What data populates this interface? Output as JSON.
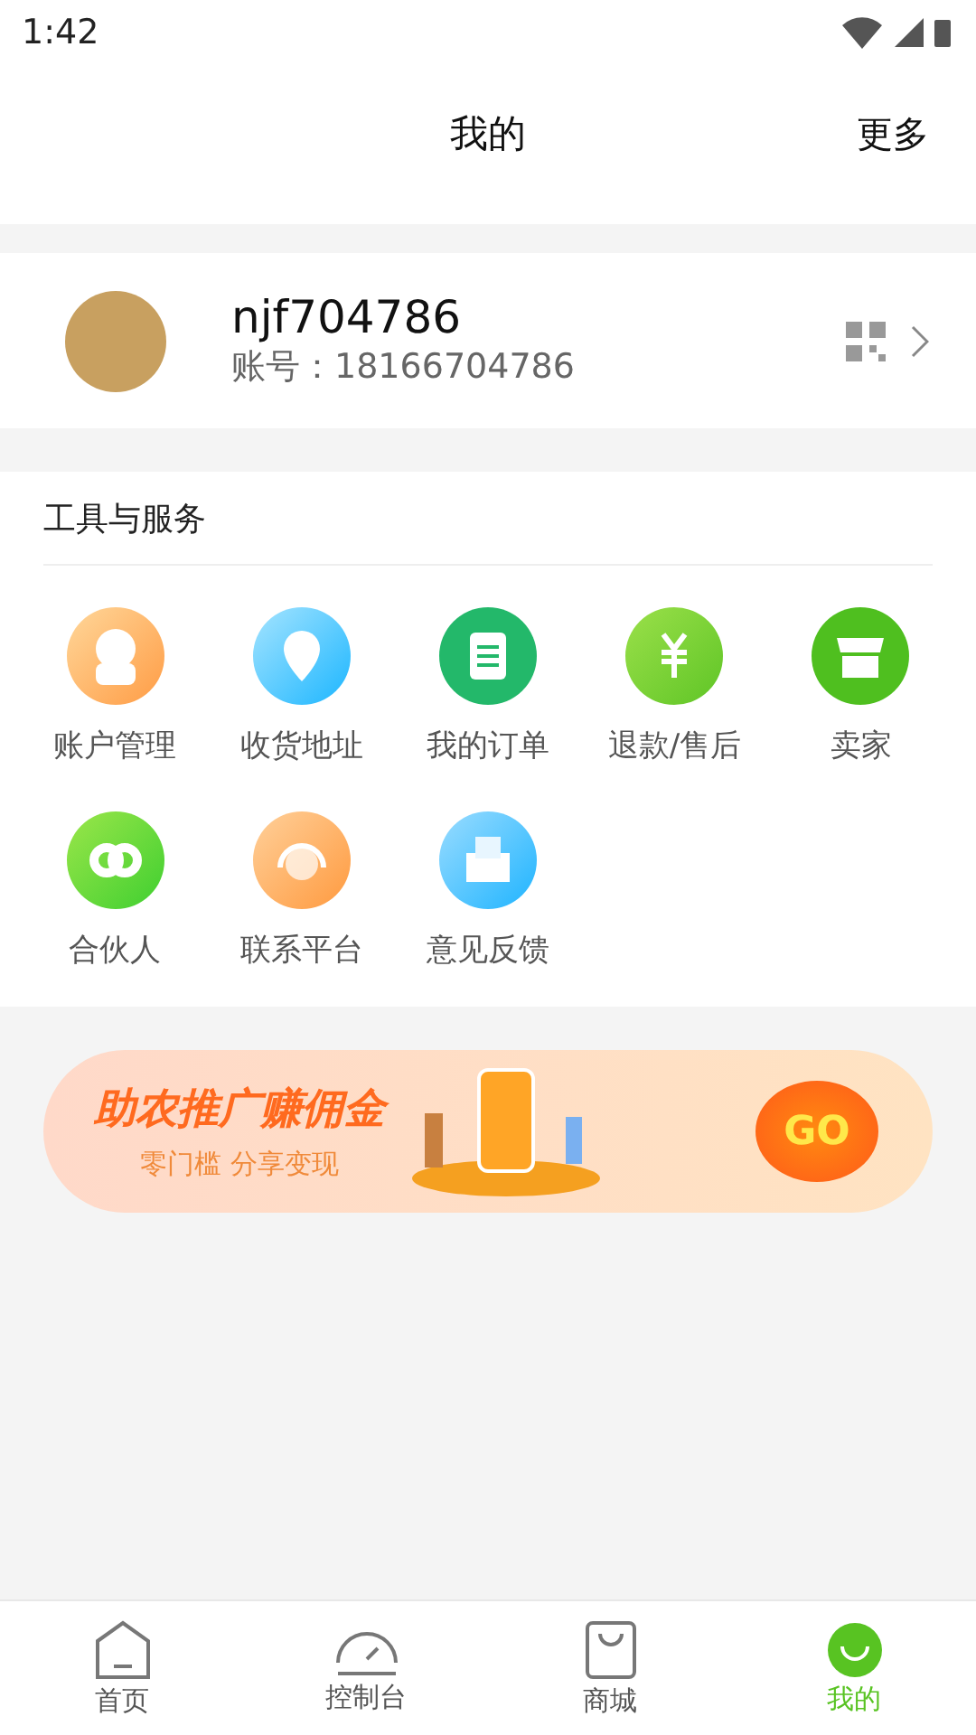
{
  "status_bar": {
    "time": "1:42"
  },
  "header": {
    "title": "我的",
    "action": "更多"
  },
  "profile": {
    "name": "njf704786",
    "account": "账号：18166704786"
  },
  "tools": {
    "title": "工具与服务",
    "items": [
      {
        "label": "账户管理"
      },
      {
        "label": "收货地址"
      },
      {
        "label": "我的订单"
      },
      {
        "label": "退款/售后"
      },
      {
        "label": "卖家"
      },
      {
        "label": "合伙人"
      },
      {
        "label": "联系平台"
      },
      {
        "label": "意见反馈"
      }
    ]
  },
  "banner": {
    "title": "助农推广赚佣金",
    "subtitle": "零门槛 分享变现",
    "button": "GO"
  },
  "tab_bar": [
    {
      "label": "首页",
      "selected": false
    },
    {
      "label": "控制台",
      "selected": false
    },
    {
      "label": "商城",
      "selected": false
    },
    {
      "label": "我的",
      "selected": true
    }
  ]
}
